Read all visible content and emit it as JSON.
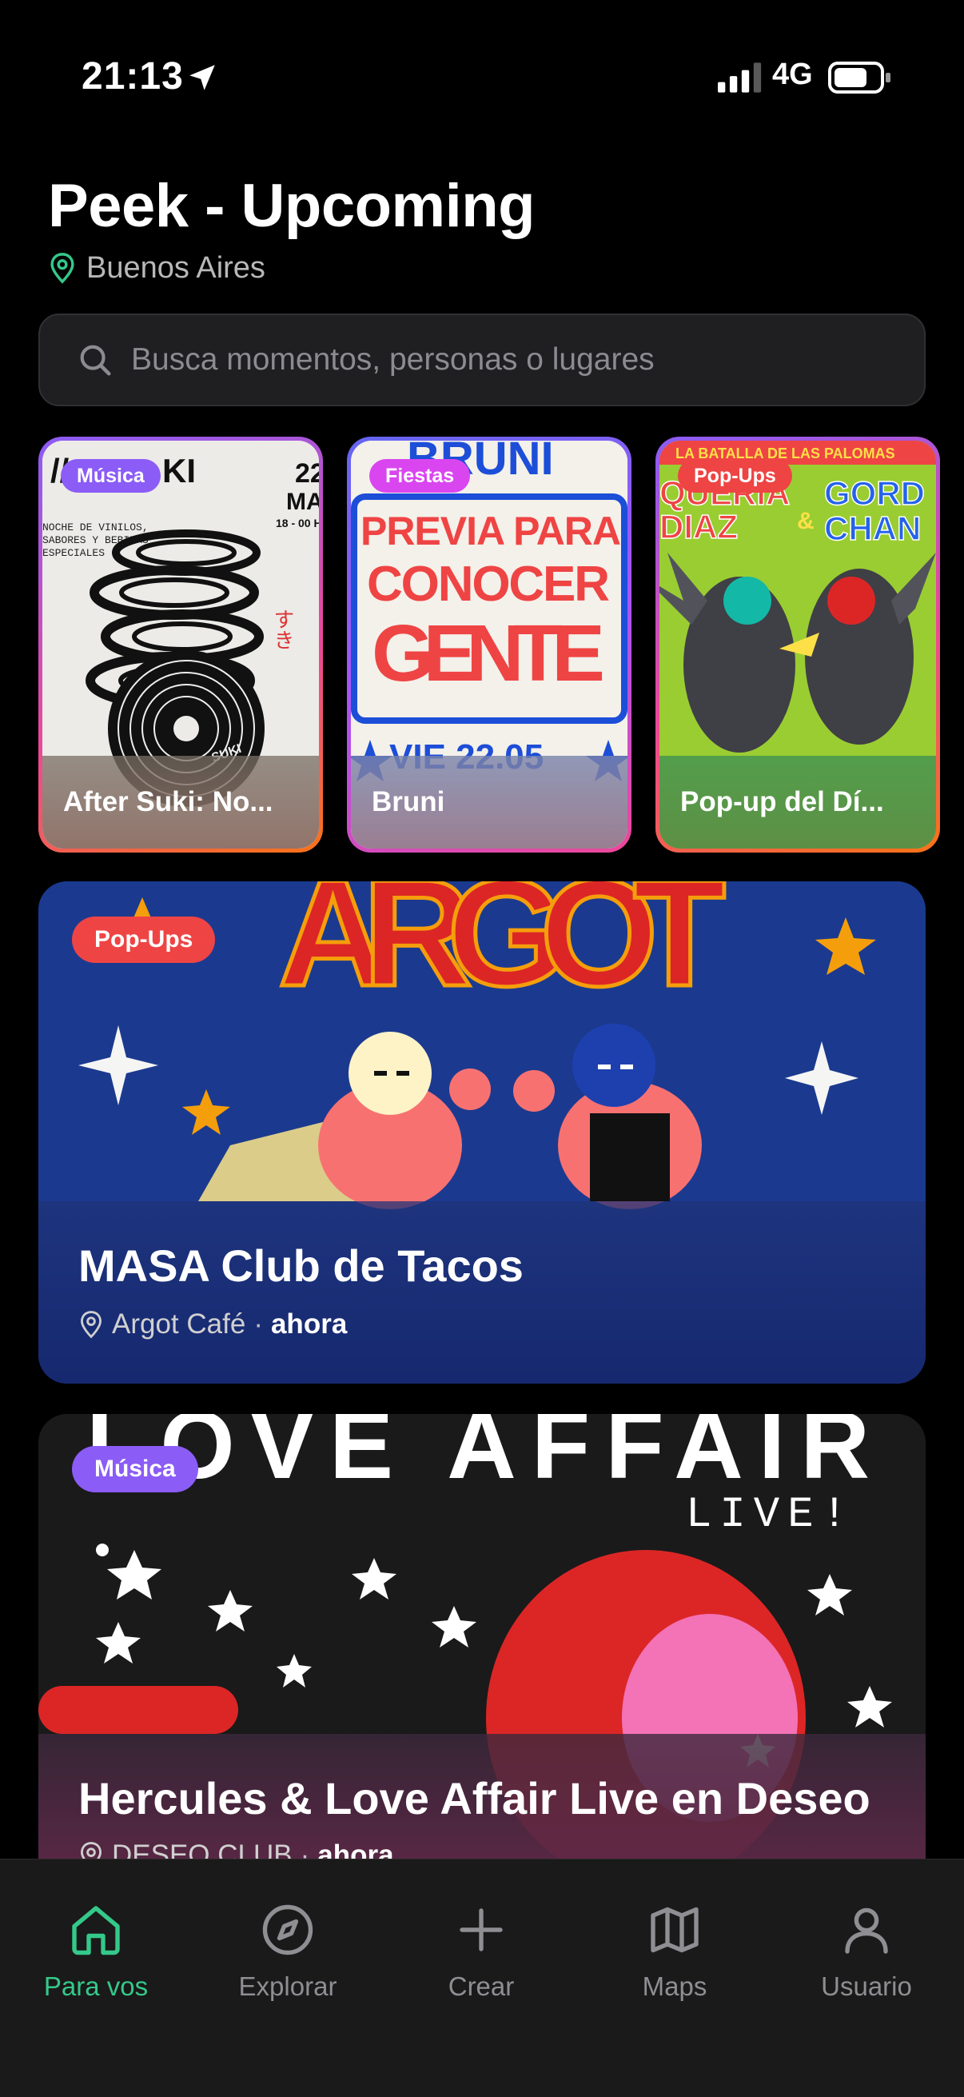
{
  "status_bar": {
    "time": "21:13",
    "network": "4G"
  },
  "header": {
    "title": "Peek - Upcoming",
    "city": "Buenos Aires"
  },
  "search": {
    "placeholder": "Busca momentos, personas o lugares"
  },
  "stories": [
    {
      "tag": "Música",
      "title": "After Suki: No...",
      "tag_color": "#8b5cf6",
      "poster_text": [
        "22",
        "MAY",
        "18 - 00 H",
        "NOCHE DE VINILOS,",
        "SABORES Y BEBIDAS",
        "ESPECIALES",
        "SUKI",
        "すき"
      ]
    },
    {
      "tag": "Fiestas",
      "title": "Bruni",
      "tag_color": "#d946ef",
      "poster_text": [
        "BRUNI",
        "PREVIA PARA",
        "CONOCER",
        "GENTE",
        "VIE 22.05"
      ]
    },
    {
      "tag": "Pop-Ups",
      "title": "Pop-up del Dí...",
      "tag_color": "#ef4444",
      "poster_text": [
        "LA BATALLA DE LAS PALOMAS",
        "QUERIA",
        "DIAZ",
        "GORD",
        "CHAN",
        "&"
      ]
    }
  ],
  "events": [
    {
      "tag": "Pop-Ups",
      "title": "MASA Club de Tacos",
      "venue": "Argot Café",
      "separator": "·",
      "when": "ahora",
      "poster_text": "ARGOT",
      "tag_color": "#ef4444"
    },
    {
      "tag": "Música",
      "title": "Hercules & Love Affair Live en Deseo",
      "venue": "DESEO CLUB",
      "separator": "·",
      "when": "ahora",
      "poster_text": "LOVE AFFAIR",
      "poster_subtext": "LIVE!",
      "tag_color": "#8b5cf6"
    }
  ],
  "tabbar": [
    {
      "label": "Para vos",
      "icon": "home-icon",
      "active": true
    },
    {
      "label": "Explorar",
      "icon": "compass-icon",
      "active": false
    },
    {
      "label": "Crear",
      "icon": "plus-icon",
      "active": false
    },
    {
      "label": "Maps",
      "icon": "map-icon",
      "active": false
    },
    {
      "label": "Usuario",
      "icon": "user-icon",
      "active": false
    }
  ],
  "colors": {
    "accent": "#34c98a",
    "background": "#000000",
    "tabbar": "#1a1a1a"
  }
}
